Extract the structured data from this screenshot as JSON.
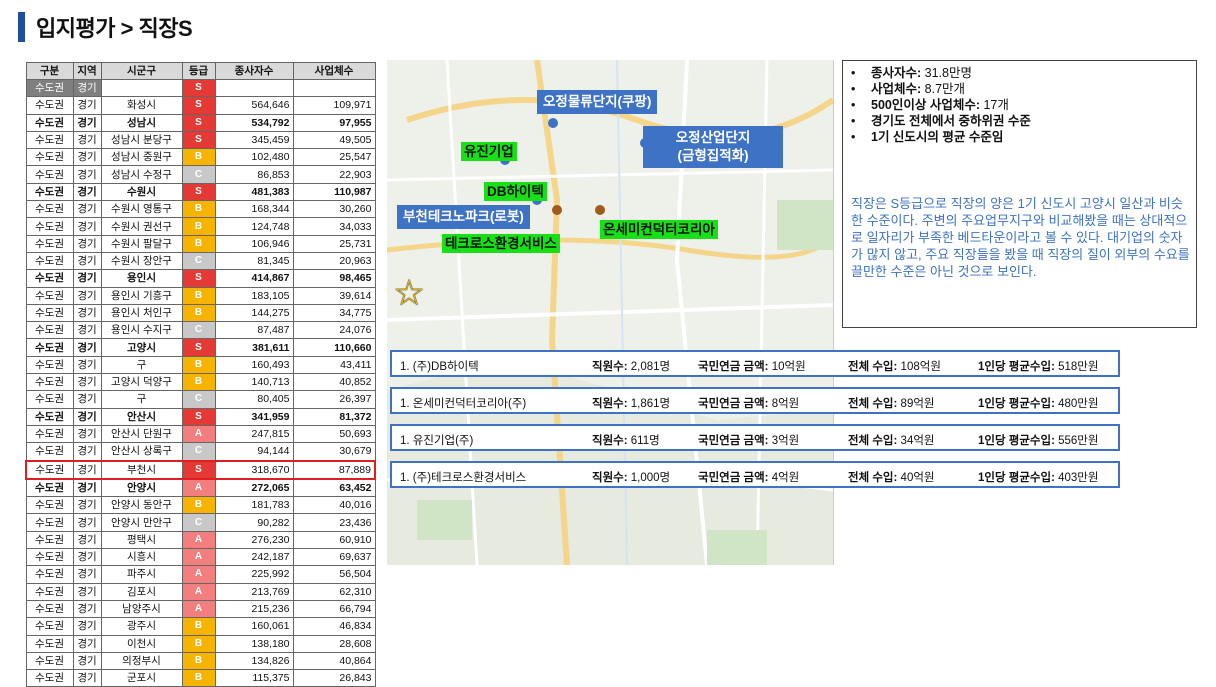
{
  "header": {
    "title": "입지평가 > 직장S"
  },
  "table": {
    "columns": [
      "구분",
      "지역",
      "시군구",
      "등급",
      "종사자수",
      "사업체수"
    ],
    "rows": [
      {
        "region": "수도권",
        "area": "경기",
        "city": "",
        "grade": "S",
        "workers": "",
        "companies": "",
        "style": "sub"
      },
      {
        "region": "수도권",
        "area": "경기",
        "city": "화성시",
        "grade": "S",
        "workers": "564,646",
        "companies": "109,971",
        "style": ""
      },
      {
        "region": "수도권",
        "area": "경기",
        "city": "성남시",
        "grade": "S",
        "workers": "534,792",
        "companies": "97,955",
        "style": "bold"
      },
      {
        "region": "수도권",
        "area": "경기",
        "city": "성남시 분당구",
        "grade": "S",
        "workers": "345,459",
        "companies": "49,505",
        "style": ""
      },
      {
        "region": "수도권",
        "area": "경기",
        "city": "성남시 중원구",
        "grade": "B",
        "workers": "102,480",
        "companies": "25,547",
        "style": ""
      },
      {
        "region": "수도권",
        "area": "경기",
        "city": "성남시 수정구",
        "grade": "C",
        "workers": "86,853",
        "companies": "22,903",
        "style": ""
      },
      {
        "region": "수도권",
        "area": "경기",
        "city": "수원시",
        "grade": "S",
        "workers": "481,383",
        "companies": "110,987",
        "style": "bold"
      },
      {
        "region": "수도권",
        "area": "경기",
        "city": "수원시 영통구",
        "grade": "B",
        "workers": "168,344",
        "companies": "30,260",
        "style": ""
      },
      {
        "region": "수도권",
        "area": "경기",
        "city": "수원시 권선구",
        "grade": "B",
        "workers": "124,748",
        "companies": "34,033",
        "style": ""
      },
      {
        "region": "수도권",
        "area": "경기",
        "city": "수원시 팔달구",
        "grade": "B",
        "workers": "106,946",
        "companies": "25,731",
        "style": ""
      },
      {
        "region": "수도권",
        "area": "경기",
        "city": "수원시 장안구",
        "grade": "C",
        "workers": "81,345",
        "companies": "20,963",
        "style": ""
      },
      {
        "region": "수도권",
        "area": "경기",
        "city": "용인시",
        "grade": "S",
        "workers": "414,867",
        "companies": "98,465",
        "style": "bold"
      },
      {
        "region": "수도권",
        "area": "경기",
        "city": "용인시 기흥구",
        "grade": "B",
        "workers": "183,105",
        "companies": "39,614",
        "style": ""
      },
      {
        "region": "수도권",
        "area": "경기",
        "city": "용인시 처인구",
        "grade": "B",
        "workers": "144,275",
        "companies": "34,775",
        "style": ""
      },
      {
        "region": "수도권",
        "area": "경기",
        "city": "용인시 수지구",
        "grade": "C",
        "workers": "87,487",
        "companies": "24,076",
        "style": ""
      },
      {
        "region": "수도권",
        "area": "경기",
        "city": "고양시",
        "grade": "S",
        "workers": "381,611",
        "companies": "110,660",
        "style": "bold"
      },
      {
        "region": "수도권",
        "area": "경기",
        "city": "구",
        "grade": "B",
        "workers": "160,493",
        "companies": "43,411",
        "style": ""
      },
      {
        "region": "수도권",
        "area": "경기",
        "city": "고양시 덕양구",
        "grade": "B",
        "workers": "140,713",
        "companies": "40,852",
        "style": ""
      },
      {
        "region": "수도권",
        "area": "경기",
        "city": "구",
        "grade": "C",
        "workers": "80,405",
        "companies": "26,397",
        "style": ""
      },
      {
        "region": "수도권",
        "area": "경기",
        "city": "안산시",
        "grade": "S",
        "workers": "341,959",
        "companies": "81,372",
        "style": "bold"
      },
      {
        "region": "수도권",
        "area": "경기",
        "city": "안산시 단원구",
        "grade": "A",
        "workers": "247,815",
        "companies": "50,693",
        "style": ""
      },
      {
        "region": "수도권",
        "area": "경기",
        "city": "안산시 상록구",
        "grade": "C",
        "workers": "94,144",
        "companies": "30,679",
        "style": ""
      },
      {
        "region": "수도권",
        "area": "경기",
        "city": "부천시",
        "grade": "S",
        "workers": "318,670",
        "companies": "87,889",
        "style": "hl"
      },
      {
        "region": "수도권",
        "area": "경기",
        "city": "안양시",
        "grade": "A",
        "workers": "272,065",
        "companies": "63,452",
        "style": "bold"
      },
      {
        "region": "수도권",
        "area": "경기",
        "city": "안양시 동안구",
        "grade": "B",
        "workers": "181,783",
        "companies": "40,016",
        "style": ""
      },
      {
        "region": "수도권",
        "area": "경기",
        "city": "안양시 만안구",
        "grade": "C",
        "workers": "90,282",
        "companies": "23,436",
        "style": ""
      },
      {
        "region": "수도권",
        "area": "경기",
        "city": "평택시",
        "grade": "A",
        "workers": "276,230",
        "companies": "60,910",
        "style": ""
      },
      {
        "region": "수도권",
        "area": "경기",
        "city": "시흥시",
        "grade": "A",
        "workers": "242,187",
        "companies": "69,637",
        "style": ""
      },
      {
        "region": "수도권",
        "area": "경기",
        "city": "파주시",
        "grade": "A",
        "workers": "225,992",
        "companies": "56,504",
        "style": ""
      },
      {
        "region": "수도권",
        "area": "경기",
        "city": "김포시",
        "grade": "A",
        "workers": "213,769",
        "companies": "62,310",
        "style": ""
      },
      {
        "region": "수도권",
        "area": "경기",
        "city": "남양주시",
        "grade": "A",
        "workers": "215,236",
        "companies": "66,794",
        "style": ""
      },
      {
        "region": "수도권",
        "area": "경기",
        "city": "광주시",
        "grade": "B",
        "workers": "160,061",
        "companies": "46,834",
        "style": ""
      },
      {
        "region": "수도권",
        "area": "경기",
        "city": "이천시",
        "grade": "B",
        "workers": "138,180",
        "companies": "28,608",
        "style": ""
      },
      {
        "region": "수도권",
        "area": "경기",
        "city": "의정부시",
        "grade": "B",
        "workers": "134,826",
        "companies": "40,864",
        "style": ""
      },
      {
        "region": "수도권",
        "area": "경기",
        "city": "군포시",
        "grade": "B",
        "workers": "115,375",
        "companies": "26,843",
        "style": ""
      }
    ]
  },
  "map": {
    "labels": {
      "osung_logistics": "오정물류단지(쿠팡)",
      "osung_industrial_1": "오정산업단지",
      "osung_industrial_2": "(금형집적화)",
      "yujin": "유진기업",
      "db_hitek": "DB하이텍",
      "bucheon_techno": "부천테크노파크(로봇)",
      "onsemi": "온세미컨덕터코리아",
      "techross": "테크로스환경서비스"
    },
    "star_icon": "star-icon"
  },
  "info": {
    "bullets": [
      {
        "label": "종사자수:",
        "value": " 31.8만명"
      },
      {
        "label": "사업체수:",
        "value": " 8.7만개"
      },
      {
        "label": "500인이상 사업체수:",
        "value": " 17개"
      },
      {
        "label": "경기도 전체에서 중하위권 수준",
        "value": ""
      },
      {
        "label": "1기 신도시의 평균 수준임",
        "value": ""
      }
    ],
    "description": "직장은 S등급으로 직장의 양은 1기 신도시 고양시 일산과 비슷한 수준이다. 주변의 주요업무지구와 비교해봤을 때는 상대적으로 일자리가 부족한 베드타운이라고 볼 수 있다. 대기업의 숫자가 많지 않고, 주요 직장들을 봤을 때 직장의 질이 외부의 수요를 끌만한 수준은 아닌 것으로 보인다."
  },
  "companies": [
    {
      "name": "1. (주)DB하이텍",
      "employees_label": "직원수:",
      "employees": " 2,081명",
      "pension_label": "국민연금 금액:",
      "pension": " 10억원",
      "income_label": "전체 수입:",
      "income": " 108억원",
      "per_label": "1인당 평균수입:",
      "per": " 518만원"
    },
    {
      "name": "1. 온세미컨덕터코리아(주)",
      "employees_label": "직원수:",
      "employees": " 1,861명",
      "pension_label": "국민연금 금액:",
      "pension": " 8억원",
      "income_label": "전체 수입:",
      "income": " 89억원",
      "per_label": "1인당 평균수입:",
      "per": " 480만원"
    },
    {
      "name": "1. 유진기업(주)",
      "employees_label": "직원수:",
      "employees": " 611명",
      "pension_label": "국민연금 금액:",
      "pension": " 3억원",
      "income_label": "전체 수입:",
      "income": " 34억원",
      "per_label": "1인당 평균수입:",
      "per": " 556만원"
    },
    {
      "name": "1. (주)테크로스환경서비스",
      "employees_label": "직원수:",
      "employees": " 1,000명",
      "pension_label": "국민연금 금액:",
      "pension": " 4억원",
      "income_label": "전체 수입:",
      "income": " 40억원",
      "per_label": "1인당 평균수입:",
      "per": " 403만원"
    }
  ],
  "colors": {
    "accent": "#3d72c4",
    "grade_S": "#e53935",
    "grade_A": "#f37e7e",
    "grade_B": "#f6b400",
    "grade_C": "#c8c8c8",
    "highlight": "#e02020",
    "label_green": "#17e017"
  }
}
